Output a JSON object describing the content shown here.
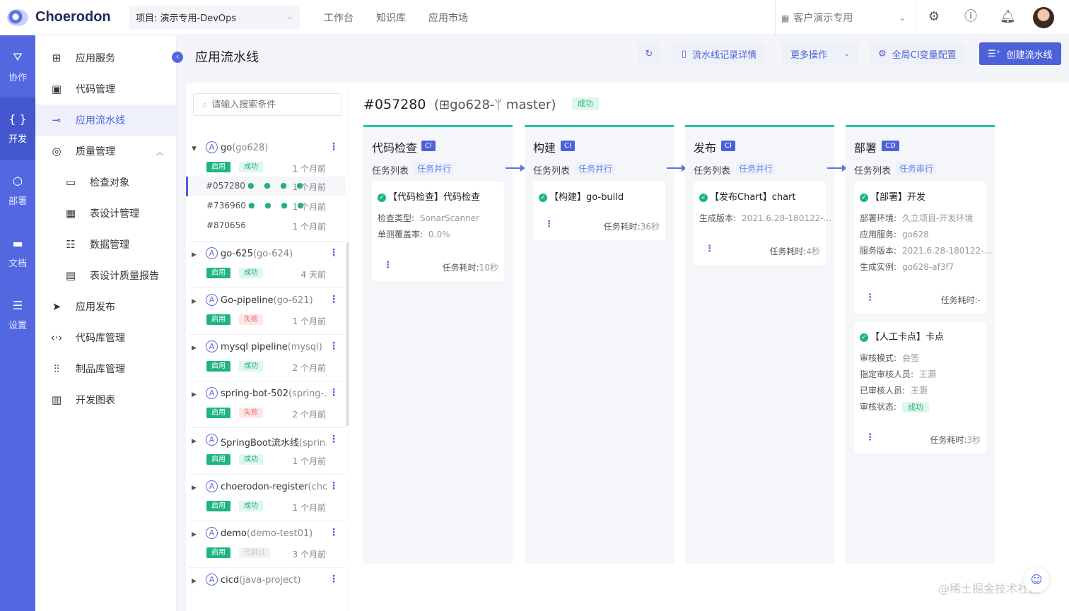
{
  "app": {
    "name": "Choerodon"
  },
  "header": {
    "project": "项目: 演示专用-DevOps",
    "nav": [
      "工作台",
      "知识库",
      "应用市场"
    ],
    "org": "客户演示专用"
  },
  "rail": [
    {
      "label": "协作",
      "icon": "collab-icon"
    },
    {
      "label": "开发",
      "icon": "code-icon"
    },
    {
      "label": "部署",
      "icon": "deploy-icon"
    },
    {
      "label": "文档",
      "icon": "doc-icon"
    },
    {
      "label": "设置",
      "icon": "settings-icon"
    }
  ],
  "menu": [
    {
      "label": "应用服务"
    },
    {
      "label": "代码管理"
    },
    {
      "label": "应用流水线"
    },
    {
      "label": "质量管理"
    },
    {
      "label": "检查对象"
    },
    {
      "label": "表设计管理"
    },
    {
      "label": "数据管理"
    },
    {
      "label": "表设计质量报告"
    },
    {
      "label": "应用发布"
    },
    {
      "label": "代码库管理"
    },
    {
      "label": "制品库管理"
    },
    {
      "label": "开发图表"
    }
  ],
  "page": {
    "title": "应用流水线",
    "buttons": {
      "records": "流水线记录详情",
      "more": "更多操作",
      "ci_vars": "全局CI变量配置",
      "create": "创建流水线"
    }
  },
  "search": {
    "placeholder": "请输入搜索条件"
  },
  "pipelines": [
    {
      "name": "go",
      "branch": "(go628)",
      "enable": "启用",
      "status": "成功",
      "time": "1 个月前",
      "records": [
        {
          "id": "#057280",
          "dots": "● ● ● ●",
          "time": "1 个月前"
        },
        {
          "id": "#736960",
          "dots": "● ● ● ●",
          "time": "1 个月前"
        },
        {
          "id": "#870656",
          "dots": "",
          "time": "1 个月前"
        }
      ]
    },
    {
      "name": "go-625",
      "branch": "(go-624)",
      "enable": "启用",
      "status": "成功",
      "time": "4 天前"
    },
    {
      "name": "Go-pipeline",
      "branch": "(go-621)",
      "enable": "启用",
      "status": "失败",
      "time": "1 个月前"
    },
    {
      "name": "mysql pipeline",
      "branch": "(mysql)",
      "enable": "启用",
      "status": "成功",
      "time": "2 个月前"
    },
    {
      "name": "spring-bot-502",
      "branch": "(spring-...",
      "enable": "启用",
      "status": "失败",
      "time": "2 个月前"
    },
    {
      "name": "SpringBoot流水线",
      "branch": "(sprin...",
      "enable": "启用",
      "status": "成功",
      "time": "1 个月前"
    },
    {
      "name": "choerodon-register",
      "branch": "(cho...",
      "enable": "启用",
      "status": "成功",
      "time": "1 个月前"
    },
    {
      "name": "demo",
      "branch": "(demo-test01)",
      "enable": "启用",
      "status": "已跳过",
      "time": "3 个月前"
    },
    {
      "name": "cicd",
      "branch": "(java-project)",
      "enable": "",
      "status": "",
      "time": ""
    }
  ],
  "detail": {
    "id": "#057280",
    "sub": "(⊞go628-ᛘ master)",
    "status": "成功"
  },
  "stages": [
    {
      "name": "代码检查",
      "type": "CI",
      "label": "任务列表",
      "mode": "任务并行",
      "tasks": [
        {
          "title": "【代码检查】代码检查",
          "kv": [
            [
              "检查类型:",
              "SonarScanner"
            ],
            [
              "单测覆盖率:",
              "0.0%"
            ]
          ],
          "dur_label": "任务耗时:",
          "dur": "10秒"
        }
      ]
    },
    {
      "name": "构建",
      "type": "CI",
      "label": "任务列表",
      "mode": "任务并行",
      "tasks": [
        {
          "title": "【构建】go-build",
          "kv": [],
          "dur_label": "任务耗时:",
          "dur": "36秒"
        }
      ]
    },
    {
      "name": "发布",
      "type": "CI",
      "label": "任务列表",
      "mode": "任务并行",
      "tasks": [
        {
          "title": "【发布Chart】chart",
          "kv": [
            [
              "生成版本:",
              "2021.6.28-180122-..."
            ]
          ],
          "dur_label": "任务耗时:",
          "dur": "4秒"
        }
      ]
    },
    {
      "name": "部署",
      "type": "CD",
      "label": "任务列表",
      "mode": "任务串行",
      "tasks": [
        {
          "title": "【部署】开发",
          "kv": [
            [
              "部署环境:",
              "久立项目-开发环境"
            ],
            [
              "应用服务:",
              "go628"
            ],
            [
              "服务版本:",
              "2021.6.28-180122-..."
            ],
            [
              "生成实例:",
              "go628-af3f7"
            ]
          ],
          "dur_label": "任务耗时:",
          "dur": "-"
        },
        {
          "title": "【人工卡点】卡点",
          "kv": [
            [
              "审核模式:",
              "会签"
            ],
            [
              "指定审核人员:",
              "王灏"
            ],
            [
              "已审核人员:",
              "王灏"
            ],
            [
              "审核状态:",
              "成功"
            ]
          ],
          "dur_label": "任务耗时:",
          "dur": "3秒"
        }
      ]
    }
  ],
  "watermark": "@稀土掘金技术社区",
  "colors": {
    "primary": "#4d62d9",
    "rail": "#5368e0",
    "success": "#1fb583",
    "stage_top": "#1fc7a8"
  }
}
